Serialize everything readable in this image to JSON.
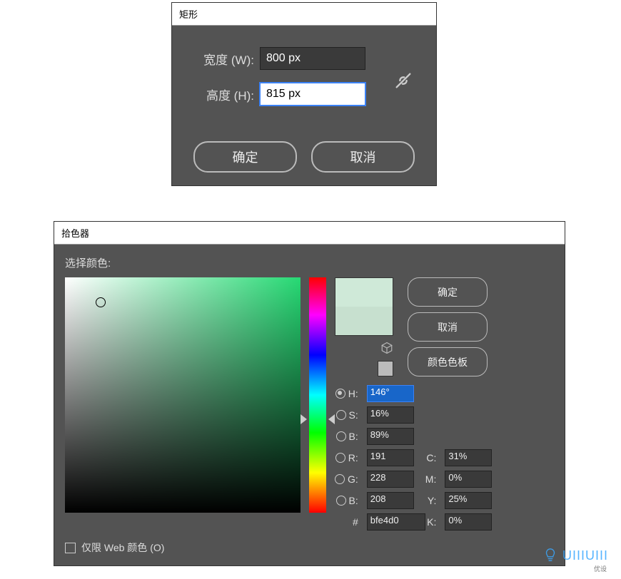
{
  "rect_dialog": {
    "title": "矩形",
    "width_label": "宽度 (W):",
    "width_value": "800 px",
    "height_label": "高度 (H):",
    "height_value": "815 px",
    "ok": "确定",
    "cancel": "取消"
  },
  "picker_dialog": {
    "title": "拾色器",
    "select_label": "选择颜色:",
    "ok": "确定",
    "cancel": "取消",
    "swatches": "颜色色板",
    "H_label": "H:",
    "S_label": "S:",
    "B_label": "B:",
    "R_label": "R:",
    "G_label": "G:",
    "Bp_label": "B:",
    "C_label": "C:",
    "M_label": "M:",
    "Y_label": "Y:",
    "K_label": "K:",
    "hash": "#",
    "H_value": "146°",
    "S_value": "16%",
    "B_value": "89%",
    "R_value": "191",
    "G_value": "228",
    "Bp_value": "208",
    "C_value": "31%",
    "M_value": "0%",
    "Y_value": "25%",
    "K_value": "0%",
    "hex_value": "bfe4d0",
    "web_only": "仅限 Web 颜色 (O)",
    "new_color": "#cfe9d8",
    "old_color": "#c7e0cf"
  },
  "watermark": {
    "brand": "UIIIUIII",
    "sub": "优设"
  }
}
